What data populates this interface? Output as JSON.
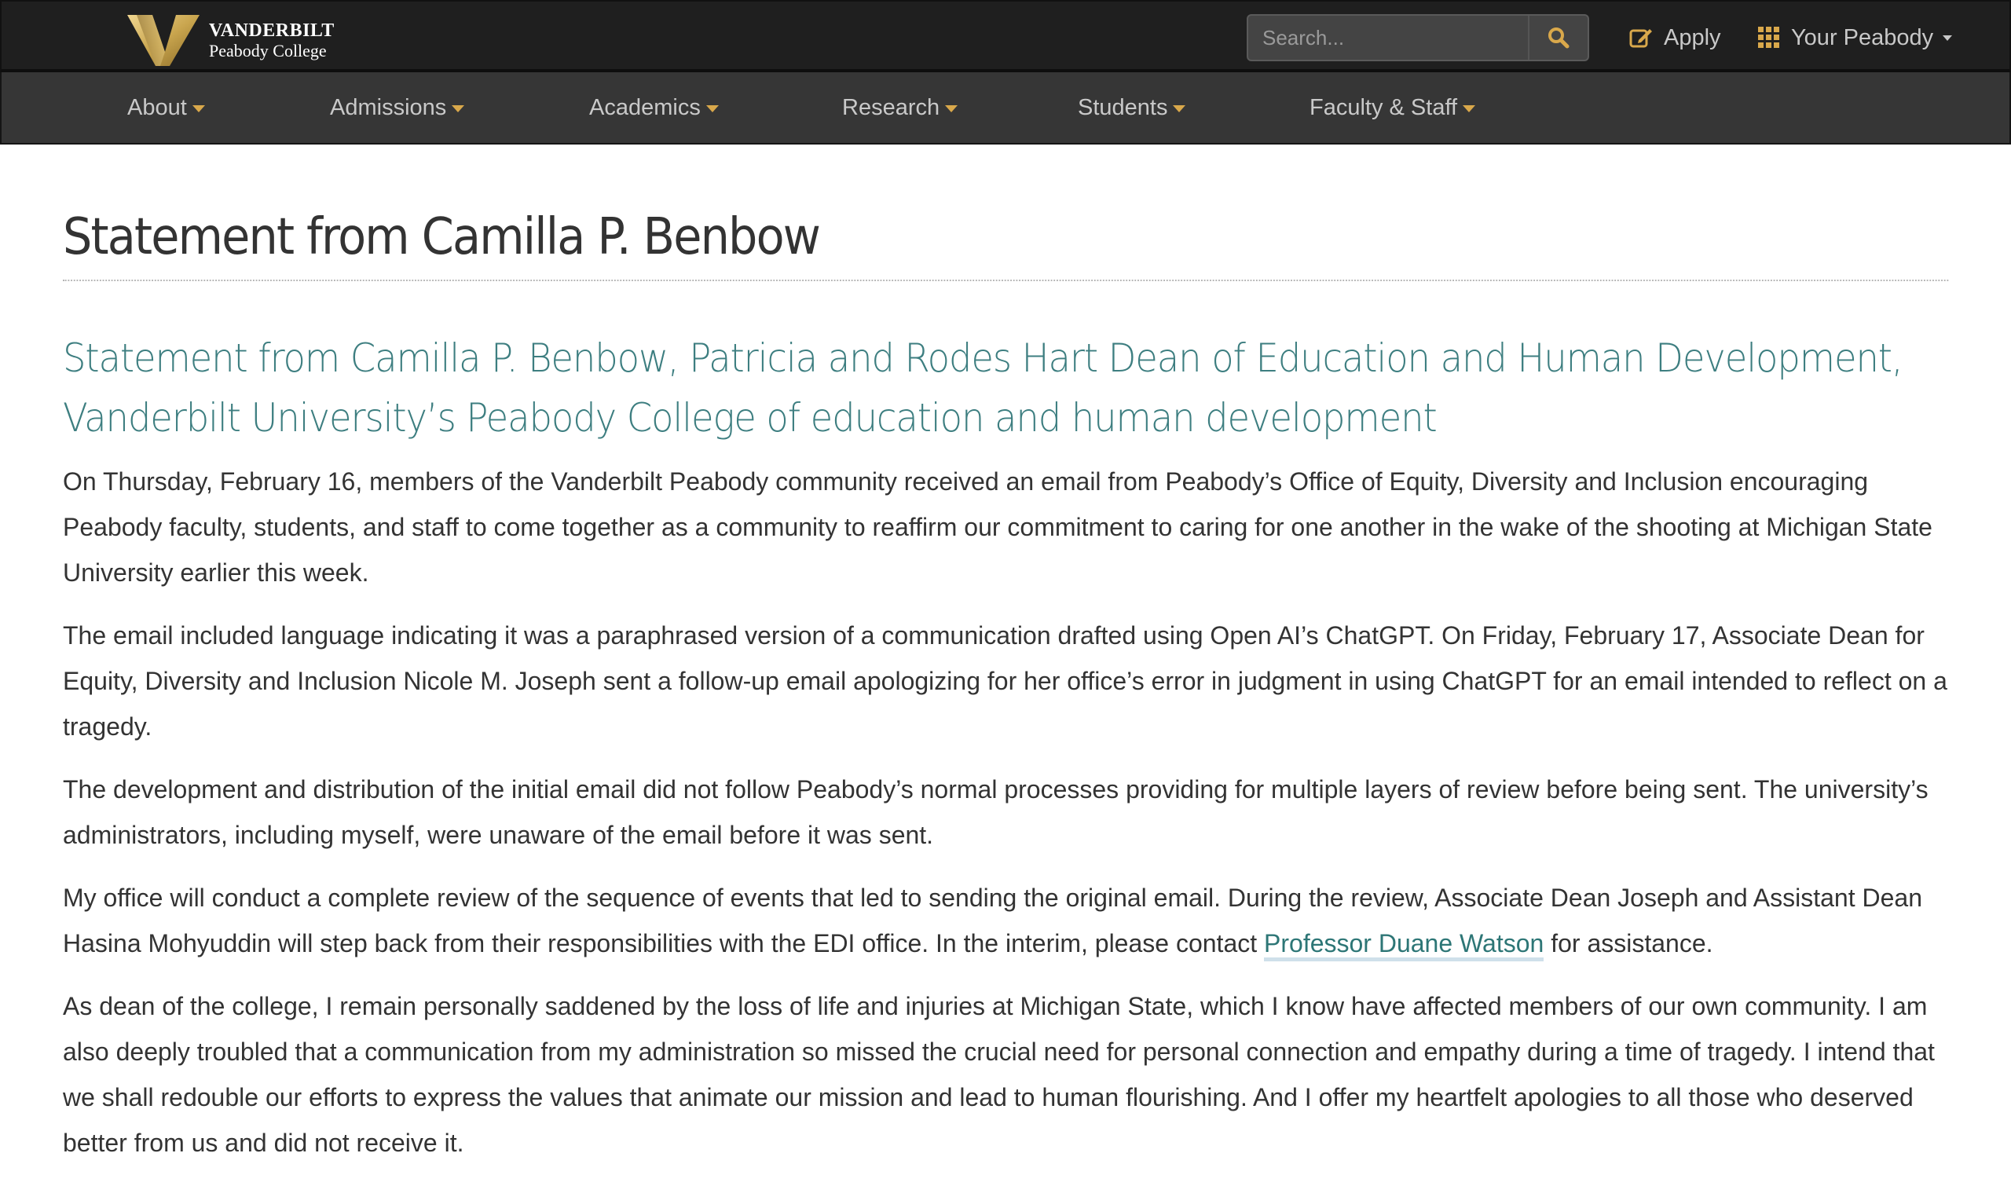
{
  "header": {
    "logo": {
      "line1": "VANDERBILT",
      "line2": "Peabody College"
    },
    "search": {
      "placeholder": "Search...",
      "value": ""
    },
    "apply_label": "Apply",
    "your_peabody_label": "Your Peabody",
    "accent_color": "#d9a84b"
  },
  "nav": {
    "items": [
      {
        "label": "About"
      },
      {
        "label": "Admissions"
      },
      {
        "label": "Academics"
      },
      {
        "label": "Research"
      },
      {
        "label": "Students"
      },
      {
        "label": "Faculty & Staff"
      }
    ]
  },
  "article": {
    "title": "Statement from Camilla P. Benbow",
    "subtitle": "Statement from Camilla P. Benbow, Patricia and Rodes Hart Dean of Education and Human Development, Vanderbilt University’s Peabody College of education and human development",
    "paragraphs": [
      "On Thursday, February 16, members of the Vanderbilt Peabody community received an email from Peabody’s Office of Equity, Diversity and Inclusion encouraging Peabody faculty, students, and staff to come together as a community to reaffirm our commitment to caring for one another in the wake of the shooting at Michigan State University earlier this week.",
      "The email included language indicating it was a paraphrased version of a communication drafted using Open AI’s ChatGPT. On Friday, February 17, Associate Dean for Equity, Diversity and Inclusion Nicole M. Joseph sent a follow-up email apologizing for her office’s error in judgment in using ChatGPT for an email intended to reflect on a tragedy.",
      "The development and distribution of the initial email did not follow Peabody’s normal processes providing for multiple layers of review before being sent. The university’s administrators, including myself, were unaware of the email before it was sent."
    ],
    "paragraph4": {
      "before_link": "My office will conduct a complete review of the sequence of events that led to sending the original email. During the review, Associate Dean Joseph and Assistant Dean Hasina Mohyuddin will step back from their responsibilities with the EDI office. In the interim, please contact ",
      "link_text": "Professor Duane Watson",
      "after_link": " for assistance."
    },
    "paragraph5": "As dean of the college, I remain personally saddened by the loss of life and injuries at Michigan State, which I know have affected members of our own community. I am also deeply troubled that a communication from my administration so missed the crucial need for personal connection and empathy during a time of tragedy. I intend that we shall redouble our efforts to express the values that animate our mission and lead to human flourishing. And I offer my heartfelt apologies to all those who deserved better from us and did not receive it.",
    "subtitle_color": "#3d7e80",
    "link_color": "#2d7676"
  }
}
